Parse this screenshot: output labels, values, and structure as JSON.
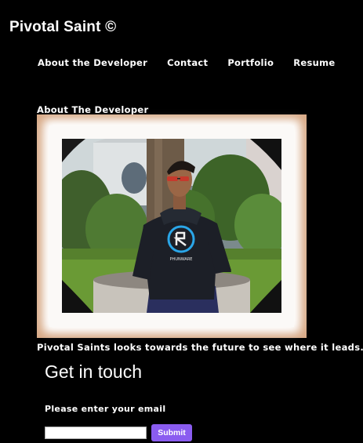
{
  "header": {
    "brand": "Pivotal Saint ©"
  },
  "nav": {
    "items": [
      {
        "label": "About the Developer"
      },
      {
        "label": "Contact"
      },
      {
        "label": "Portfolio"
      },
      {
        "label": "Resume"
      }
    ]
  },
  "about": {
    "title": "About The Developer",
    "tagline": "Pivotal Saints looks towards the future to see where it leads.",
    "shirt_text": "PHUNWARE"
  },
  "contact": {
    "title": "Get in touch",
    "email_label": "Please enter your email",
    "email_value": "",
    "submit_label": "Submit"
  },
  "colors": {
    "background": "#000000",
    "text": "#ffffff",
    "submit": "#8a5cf0",
    "frame_glow": "#d8a884"
  }
}
